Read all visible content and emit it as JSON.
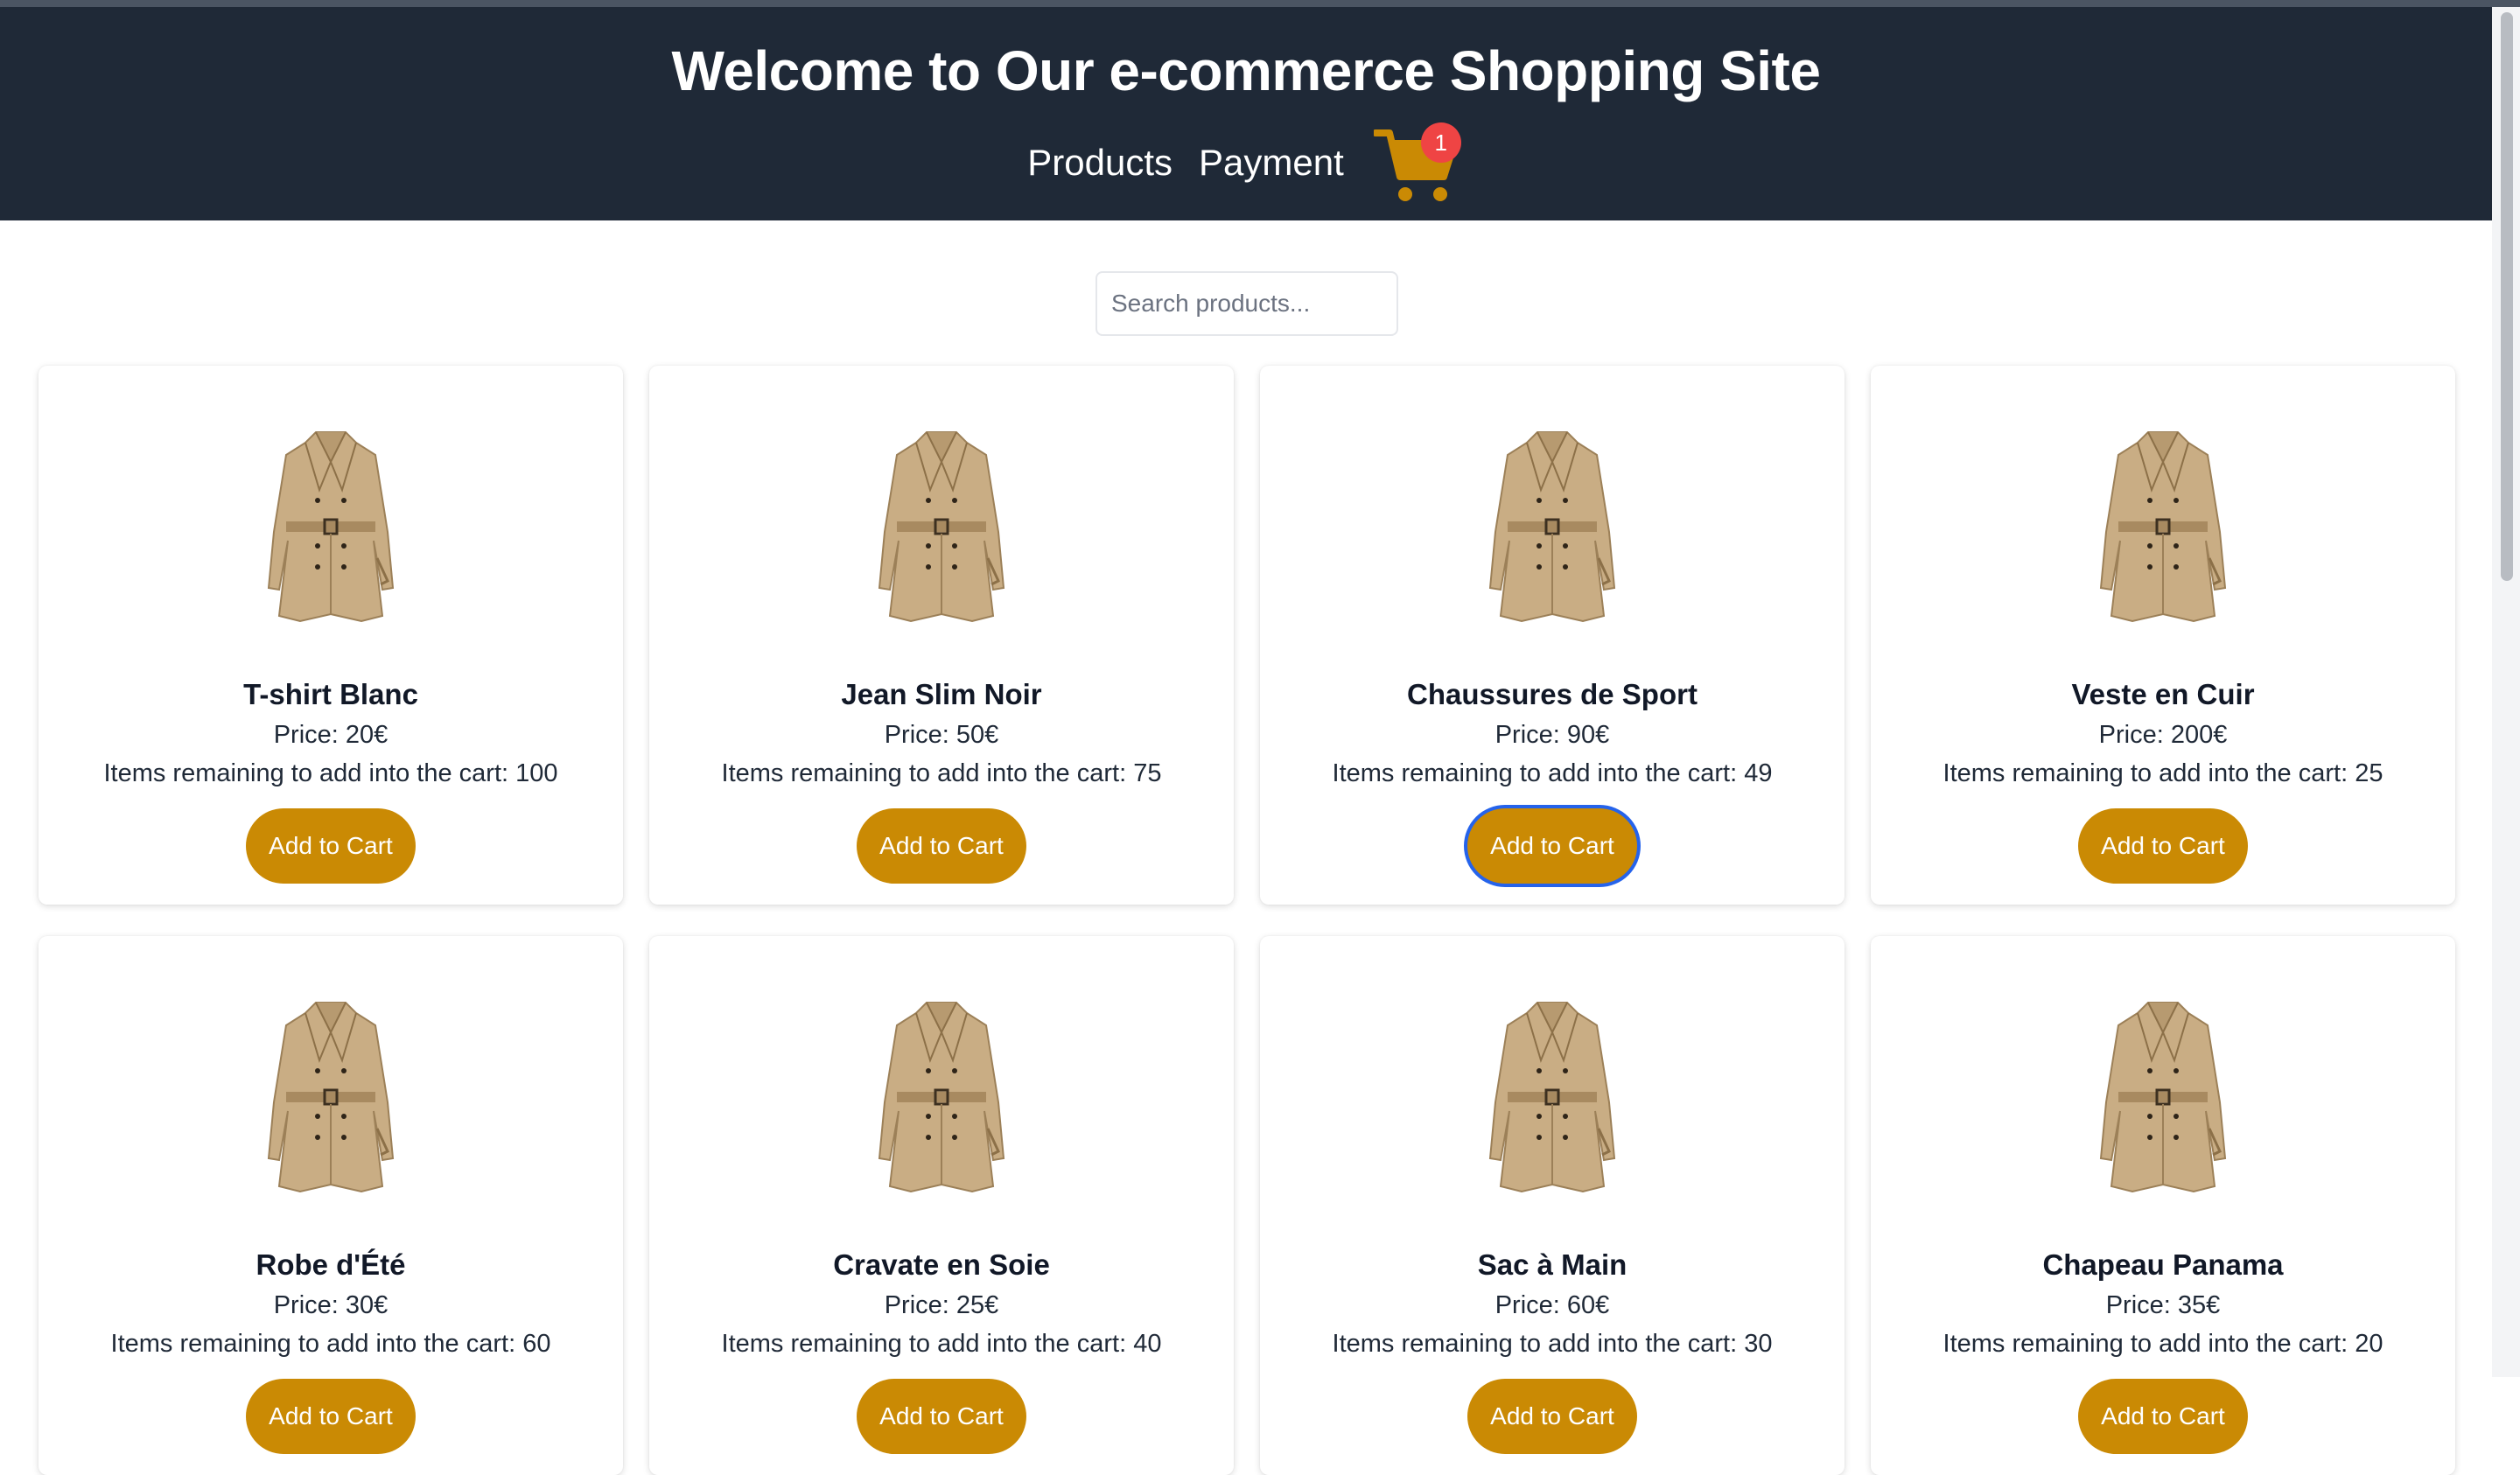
{
  "header": {
    "title": "Welcome to Our e-commerce Shopping Site",
    "nav": [
      {
        "label": "Products"
      },
      {
        "label": "Payment"
      }
    ],
    "cart": {
      "icon": "shopping-cart-icon",
      "count": "1",
      "icon_color": "#ca8a04",
      "badge_color": "#ef4444"
    }
  },
  "search": {
    "placeholder": "Search products...",
    "value": ""
  },
  "theme": {
    "header_bg": "#1f2937",
    "button_bg": "#ca8a04",
    "focus_ring": "#2563eb"
  },
  "products": [
    {
      "name": "T-shirt Blanc",
      "price": "Price: 20€",
      "stock": "Items remaining to add into the cart: 100",
      "button": "Add to Cart"
    },
    {
      "name": "Jean Slim Noir",
      "price": "Price: 50€",
      "stock": "Items remaining to add into the cart: 75",
      "button": "Add to Cart"
    },
    {
      "name": "Chaussures de Sport",
      "price": "Price: 90€",
      "stock": "Items remaining to add into the cart: 49",
      "button": "Add to Cart",
      "focused": true
    },
    {
      "name": "Veste en Cuir",
      "price": "Price: 200€",
      "stock": "Items remaining to add into the cart: 25",
      "button": "Add to Cart"
    },
    {
      "name": "Robe d'Été",
      "price": "Price: 30€",
      "stock": "Items remaining to add into the cart: 60",
      "button": "Add to Cart"
    },
    {
      "name": "Cravate en Soie",
      "price": "Price: 25€",
      "stock": "Items remaining to add into the cart: 40",
      "button": "Add to Cart"
    },
    {
      "name": "Sac à Main",
      "price": "Price: 60€",
      "stock": "Items remaining to add into the cart: 30",
      "button": "Add to Cart"
    },
    {
      "name": "Chapeau Panama",
      "price": "Price: 35€",
      "stock": "Items remaining to add into the cart: 20",
      "button": "Add to Cart"
    }
  ]
}
